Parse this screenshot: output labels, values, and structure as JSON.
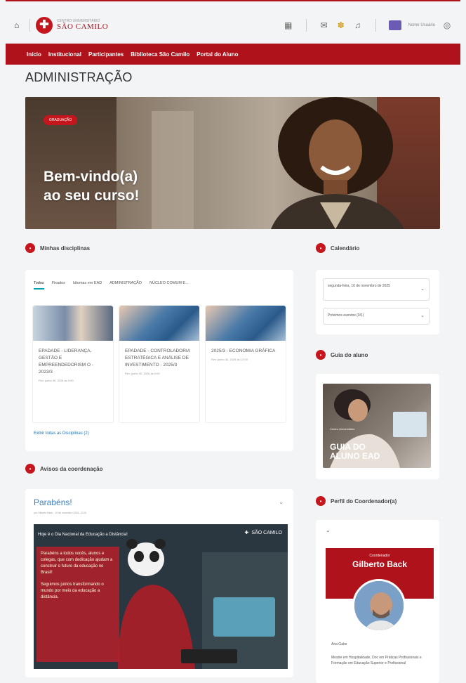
{
  "header": {
    "logo_small": "CENTRO UNIVERSITÁRIO",
    "logo_big": "SÃO CAMILO",
    "user_name": "Nome Usuário"
  },
  "nav": {
    "items": [
      "Início",
      "Institucional",
      "Participantes",
      "Biblioteca São Camilo",
      "Portal do Aluno"
    ]
  },
  "page": {
    "title": "ADMINISTRAÇÃO"
  },
  "hero": {
    "tag": "GRADUAÇÃO",
    "line1": "Bem-vindo(a)",
    "line2": "ao seu curso!"
  },
  "disciplinas": {
    "title": "Minhas disciplinas",
    "tabs": [
      "Todos",
      "Fixados",
      "Idiomas em EAD",
      "ADMINISTRAÇÃO",
      "NÚCLEO COMUM E..."
    ],
    "courses": [
      {
        "title": "EPADADE - LIDERANÇA, GESTÃO E EMPREENDEDORISM O - 2023/3",
        "sub": "Fim: junho 30, 2026 às 0:00"
      },
      {
        "title": "EPADADE - CONTROLADORIA ESTRATÉGICA E ANÁLISE DE INVESTIMENTO - 2025/3",
        "sub": "Fim: junho 30, 2026 às 0:00"
      },
      {
        "title": "2025/3 - ECONOMIA GRÁFICA",
        "sub": "Fim: junho 30, 2026 às 12:00"
      }
    ],
    "see_all": "Exibir todas as Disciplinas (2)"
  },
  "calendario": {
    "title": "Calendário",
    "items": [
      "segunda-feira, 10 de novembro de 2025",
      "Próximos eventos (0/1)"
    ]
  },
  "guia": {
    "title": "Guia do aluno",
    "sub": "Centro Universitário",
    "line1": "GUIA DO",
    "line2": "ALUNO EAD"
  },
  "avisos": {
    "title": "Avisos da coordenação",
    "notice_title": "Parabéns!",
    "meta": "por Gilberto Back - 10 de novembro 2025, 12:00",
    "image_head": "Hoje é o Dia Nacional da Educação a Distância!",
    "image_text1": "Parabéns a todos vocês, alunos e colegas, que com dedicação ajudam a construir o futuro da educação no Brasil!",
    "image_text2": "Seguimos juntos transformando o mundo por meio da educação a distância.",
    "logo_text": "SÃO CAMILO"
  },
  "perfil": {
    "title": "Perfil do Coordenador(a)",
    "label": "Coordenador",
    "name": "Gilberto Back",
    "meta": "Ana Gabs",
    "desc": "Mestre em Hospitalidade, Doc em Práticas Profissionais e Formação em Educação Superior e Profissional"
  },
  "colors": {
    "brand": "#b0121b",
    "accent": "#00a0b0",
    "link": "#1a73b8"
  }
}
